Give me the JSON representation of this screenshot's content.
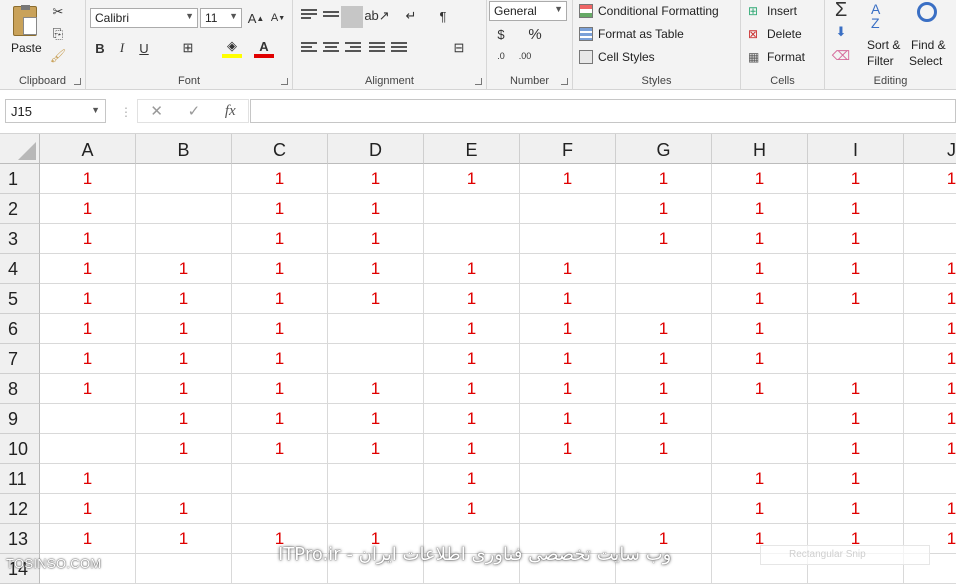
{
  "ribbon": {
    "clipboard": {
      "paste": "Paste",
      "label": "Clipboard"
    },
    "font": {
      "name": "Calibri",
      "size": "11",
      "bold": "B",
      "italic": "I",
      "underline": "U",
      "label": "Font"
    },
    "alignment": {
      "label": "Alignment"
    },
    "number": {
      "format": "General",
      "label": "Number",
      "percent": "%"
    },
    "styles": {
      "conditional": "Conditional Formatting",
      "format_table": "Format as Table",
      "cell_styles": "Cell Styles",
      "label": "Styles"
    },
    "cells": {
      "insert": "Insert",
      "delete": "Delete",
      "format": "Format",
      "label": "Cells"
    },
    "editing": {
      "sort_line1": "Sort &",
      "sort_line2": "Filter",
      "find_line1": "Find &",
      "find_line2": "Select",
      "label": "Editing"
    }
  },
  "formula_bar": {
    "name_box": "J15",
    "formula": ""
  },
  "sheet": {
    "columns": [
      "A",
      "B",
      "C",
      "D",
      "E",
      "F",
      "G",
      "H",
      "I",
      "J"
    ],
    "rows": [
      {
        "n": "1",
        "cells": [
          "1",
          "",
          "1",
          "1",
          "1",
          "1",
          "1",
          "1",
          "1",
          "1"
        ]
      },
      {
        "n": "2",
        "cells": [
          "1",
          "",
          "1",
          "1",
          "",
          "",
          "1",
          "1",
          "1",
          ""
        ]
      },
      {
        "n": "3",
        "cells": [
          "1",
          "",
          "1",
          "1",
          "",
          "",
          "1",
          "1",
          "1",
          ""
        ]
      },
      {
        "n": "4",
        "cells": [
          "1",
          "1",
          "1",
          "1",
          "1",
          "1",
          "",
          "1",
          "1",
          "1"
        ]
      },
      {
        "n": "5",
        "cells": [
          "1",
          "1",
          "1",
          "1",
          "1",
          "1",
          "",
          "1",
          "1",
          "1"
        ]
      },
      {
        "n": "6",
        "cells": [
          "1",
          "1",
          "1",
          "",
          "1",
          "1",
          "1",
          "1",
          "",
          "1"
        ]
      },
      {
        "n": "7",
        "cells": [
          "1",
          "1",
          "1",
          "",
          "1",
          "1",
          "1",
          "1",
          "",
          "1"
        ]
      },
      {
        "n": "8",
        "cells": [
          "1",
          "1",
          "1",
          "1",
          "1",
          "1",
          "1",
          "1",
          "1",
          "1"
        ]
      },
      {
        "n": "9",
        "cells": [
          "",
          "1",
          "1",
          "1",
          "1",
          "1",
          "1",
          "",
          "1",
          "1"
        ]
      },
      {
        "n": "10",
        "cells": [
          "",
          "1",
          "1",
          "1",
          "1",
          "1",
          "1",
          "",
          "1",
          "1"
        ]
      },
      {
        "n": "11",
        "cells": [
          "1",
          "",
          "",
          "",
          "1",
          "",
          "",
          "1",
          "1",
          ""
        ]
      },
      {
        "n": "12",
        "cells": [
          "1",
          "1",
          "",
          "",
          "1",
          "",
          "",
          "1",
          "1",
          "1"
        ]
      },
      {
        "n": "13",
        "cells": [
          "1",
          "1",
          "1",
          "1",
          "",
          "",
          "1",
          "1",
          "1",
          "1"
        ]
      },
      {
        "n": "14",
        "cells": [
          "",
          "",
          "",
          "",
          "",
          "",
          "",
          "",
          "",
          ""
        ]
      }
    ]
  },
  "watermark": {
    "left": "TOSINSO.COM",
    "center": "وب سایت تخصصی فناوری اطلاعات ایران - ITPro.ir",
    "right": "Rectangular Snip"
  }
}
